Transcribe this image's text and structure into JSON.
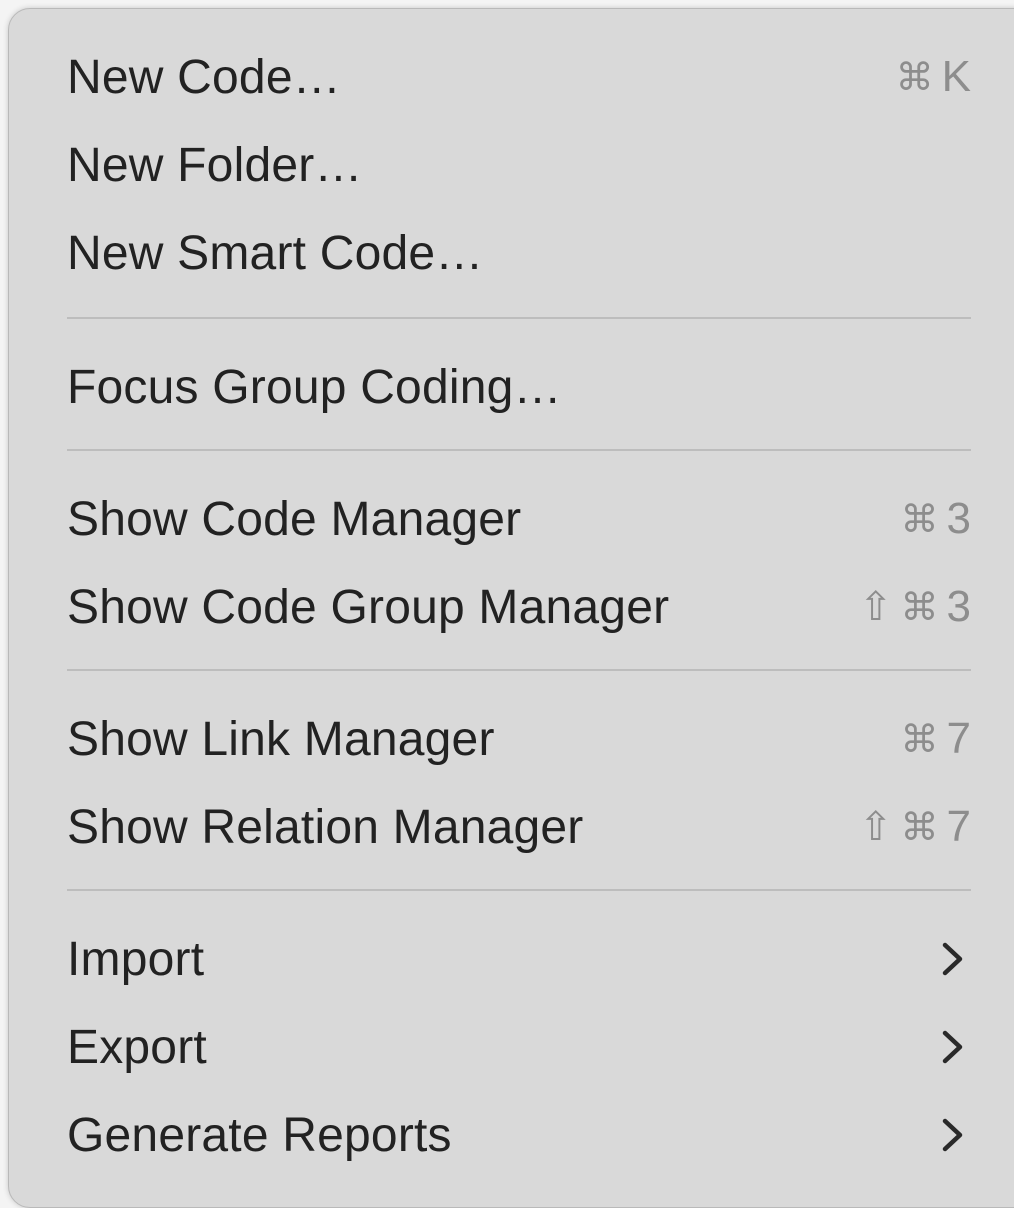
{
  "menu": {
    "items": [
      {
        "label": "New Code…",
        "shortcut_mod": "⌘",
        "shortcut_key": "K"
      },
      {
        "label": "New Folder…"
      },
      {
        "label": "New Smart Code…"
      },
      {
        "label": "Focus Group Coding…"
      },
      {
        "label": "Show Code Manager",
        "shortcut_mod": "⌘",
        "shortcut_key": "3"
      },
      {
        "label": "Show Code Group Manager",
        "shortcut_shift": "⇧",
        "shortcut_mod": "⌘",
        "shortcut_key": "3"
      },
      {
        "label": "Show Link Manager",
        "shortcut_mod": "⌘",
        "shortcut_key": "7"
      },
      {
        "label": "Show Relation Manager",
        "shortcut_shift": "⇧",
        "shortcut_mod": "⌘",
        "shortcut_key": "7"
      },
      {
        "label": "Import",
        "submenu": "chevron-right-icon"
      },
      {
        "label": "Export",
        "submenu": "chevron-right-icon"
      },
      {
        "label": "Generate Reports",
        "submenu": "chevron-right-icon"
      }
    ]
  },
  "colors": {
    "menu_background": "#d9d9d9",
    "label_text": "#222222",
    "shortcut_text": "#8d8d8d",
    "separator": "#bdbdbd"
  }
}
